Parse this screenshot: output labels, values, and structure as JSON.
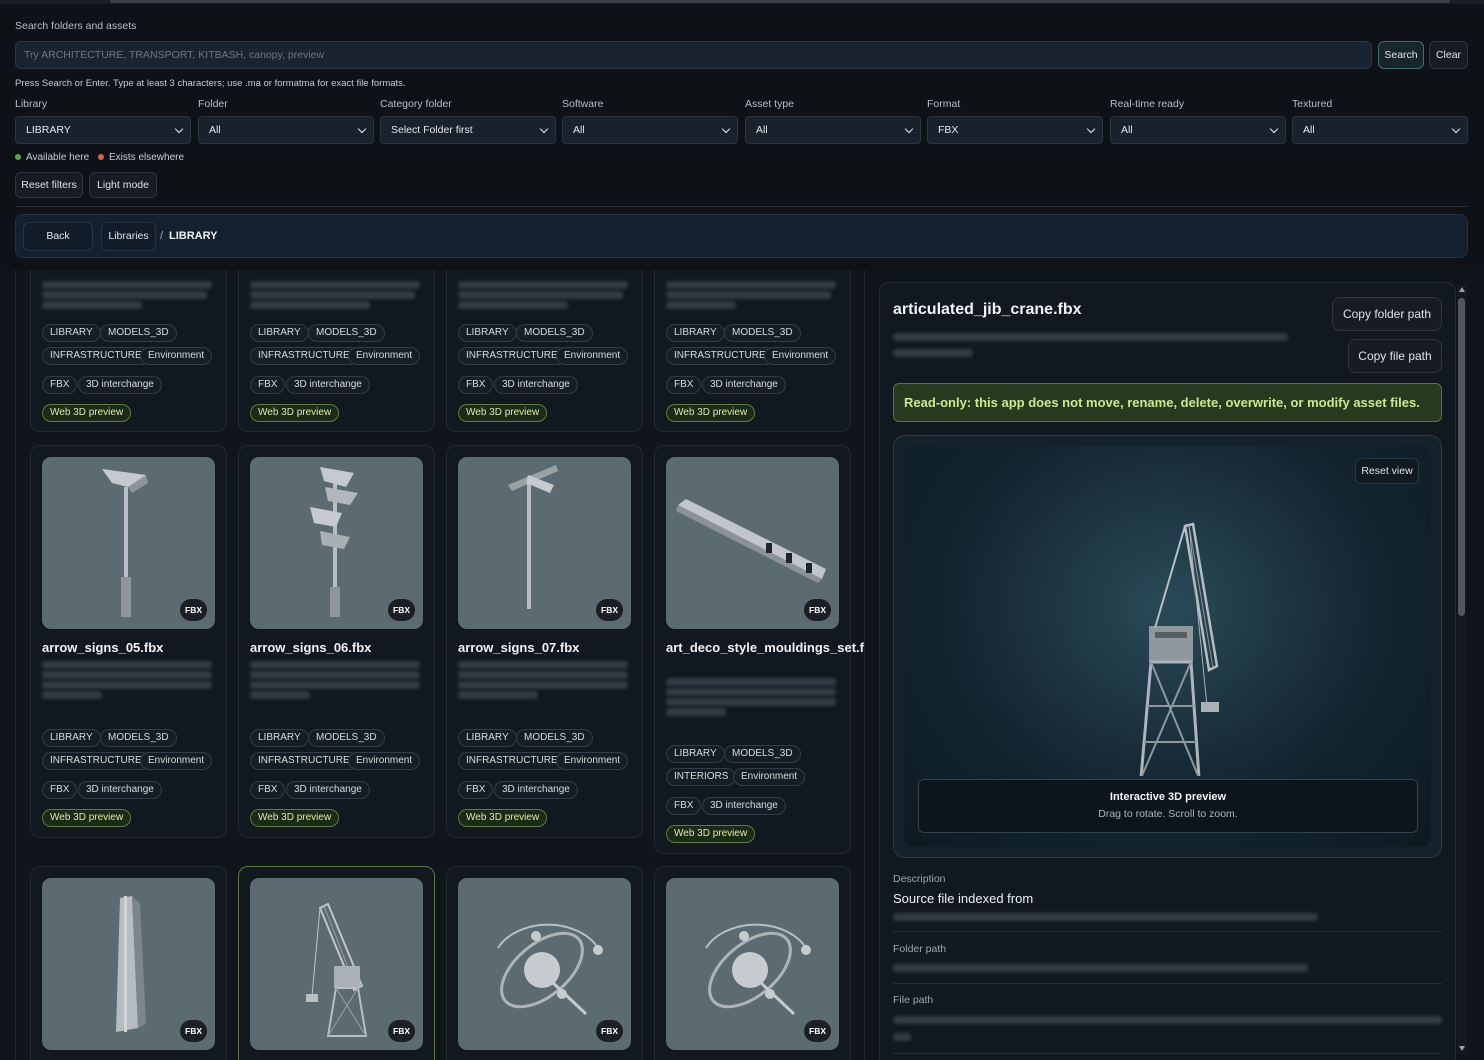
{
  "search": {
    "label": "Search folders and assets",
    "placeholder": "Try ARCHITECTURE, TRANSPORT, KITBASH, canopy, preview",
    "search_button": "Search",
    "clear_button": "Clear",
    "hint": "Press Search or Enter. Type at least 3 characters; use .ma or formatma for exact file formats."
  },
  "filters": [
    {
      "label": "Library",
      "value": "LIBRARY"
    },
    {
      "label": "Folder",
      "value": "All"
    },
    {
      "label": "Category folder",
      "value": "Select Folder first"
    },
    {
      "label": "Software",
      "value": "All"
    },
    {
      "label": "Asset type",
      "value": "All"
    },
    {
      "label": "Format",
      "value": "FBX"
    },
    {
      "label": "Real-time ready",
      "value": "All"
    },
    {
      "label": "Textured",
      "value": "All"
    }
  ],
  "legend": {
    "available": "Available here",
    "elsewhere": "Exists elsewhere",
    "available_color": "#4caf50",
    "elsewhere_color": "#e05a5a"
  },
  "actions": {
    "reset_filters": "Reset filters",
    "light_mode": "Light mode"
  },
  "nav": {
    "back": "Back",
    "libraries": "Libraries",
    "separator": "/",
    "current": "LIBRARY"
  },
  "tags": {
    "library": "LIBRARY",
    "models": "MODELS_3D",
    "infrastructure": "INFRASTRUCTURE",
    "interiors": "INTERIORS",
    "environment": "Environment",
    "fbx": "FBX",
    "interchange": "3D interchange",
    "web_preview": "Web 3D preview"
  },
  "cards": [
    {
      "name": "arrow_signs_05.fbx",
      "badge": "FBX",
      "category": "INFRASTRUCTURE"
    },
    {
      "name": "arrow_signs_06.fbx",
      "badge": "FBX",
      "category": "INFRASTRUCTURE"
    },
    {
      "name": "arrow_signs_07.fbx",
      "badge": "FBX",
      "category": "INFRASTRUCTURE"
    },
    {
      "name": "art_deco_style_mouldings_set.fbx",
      "badge": "FBX",
      "category": "INTERIORS"
    }
  ],
  "bottom_badges": [
    "FBX",
    "FBX",
    "FBX",
    "FBX"
  ],
  "detail": {
    "title": "articulated_jib_crane.fbx",
    "copy_folder": "Copy folder path",
    "copy_file": "Copy file path",
    "readonly": "Read-only: this app does not move, rename, delete, overwrite, or modify asset files.",
    "reset_view": "Reset view",
    "preview_title": "Interactive 3D preview",
    "preview_sub": "Drag to rotate. Scroll to zoom.",
    "description_label": "Description",
    "description_value": "Source file indexed from",
    "folder_label": "Folder path",
    "file_label": "File path"
  }
}
